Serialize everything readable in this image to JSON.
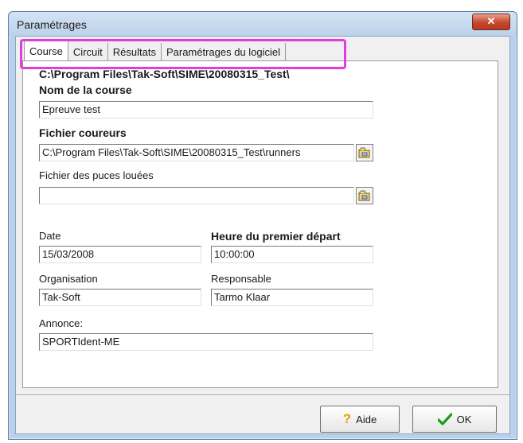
{
  "window": {
    "title": "Paramétrages",
    "close_symbol": "✕"
  },
  "tabs": [
    {
      "label": "Course",
      "active": true
    },
    {
      "label": "Circuit",
      "active": false
    },
    {
      "label": "Résultats",
      "active": false
    },
    {
      "label": "Paramétrages du logiciel",
      "active": false
    }
  ],
  "course": {
    "path_header": "C:\\Program Files\\Tak-Soft\\SIME\\20080315_Test\\",
    "nom_label": "Nom de la course",
    "nom_value": "Epreuve test",
    "fichier_coureurs_label": "Fichier coureurs",
    "fichier_coureurs_value": "C:\\Program Files\\Tak-Soft\\SIME\\20080315_Test\\runners",
    "fichier_puces_label": "Fichier des puces louées",
    "fichier_puces_value": "",
    "date_label": "Date",
    "date_value": "15/03/2008",
    "heure_label": "Heure du premier départ",
    "heure_value": "10:00:00",
    "organisation_label": "Organisation",
    "organisation_value": "Tak-Soft",
    "responsable_label": "Responsable",
    "responsable_value": "Tarmo Klaar",
    "annonce_label": "Annonce:",
    "annonce_value": "SPORTIdent-ME"
  },
  "buttons": {
    "aide": "Aide",
    "ok": "OK"
  },
  "colors": {
    "highlight": "#e03ce0",
    "ok_check": "#1e9a1e",
    "help_icon": "#e8a000"
  }
}
